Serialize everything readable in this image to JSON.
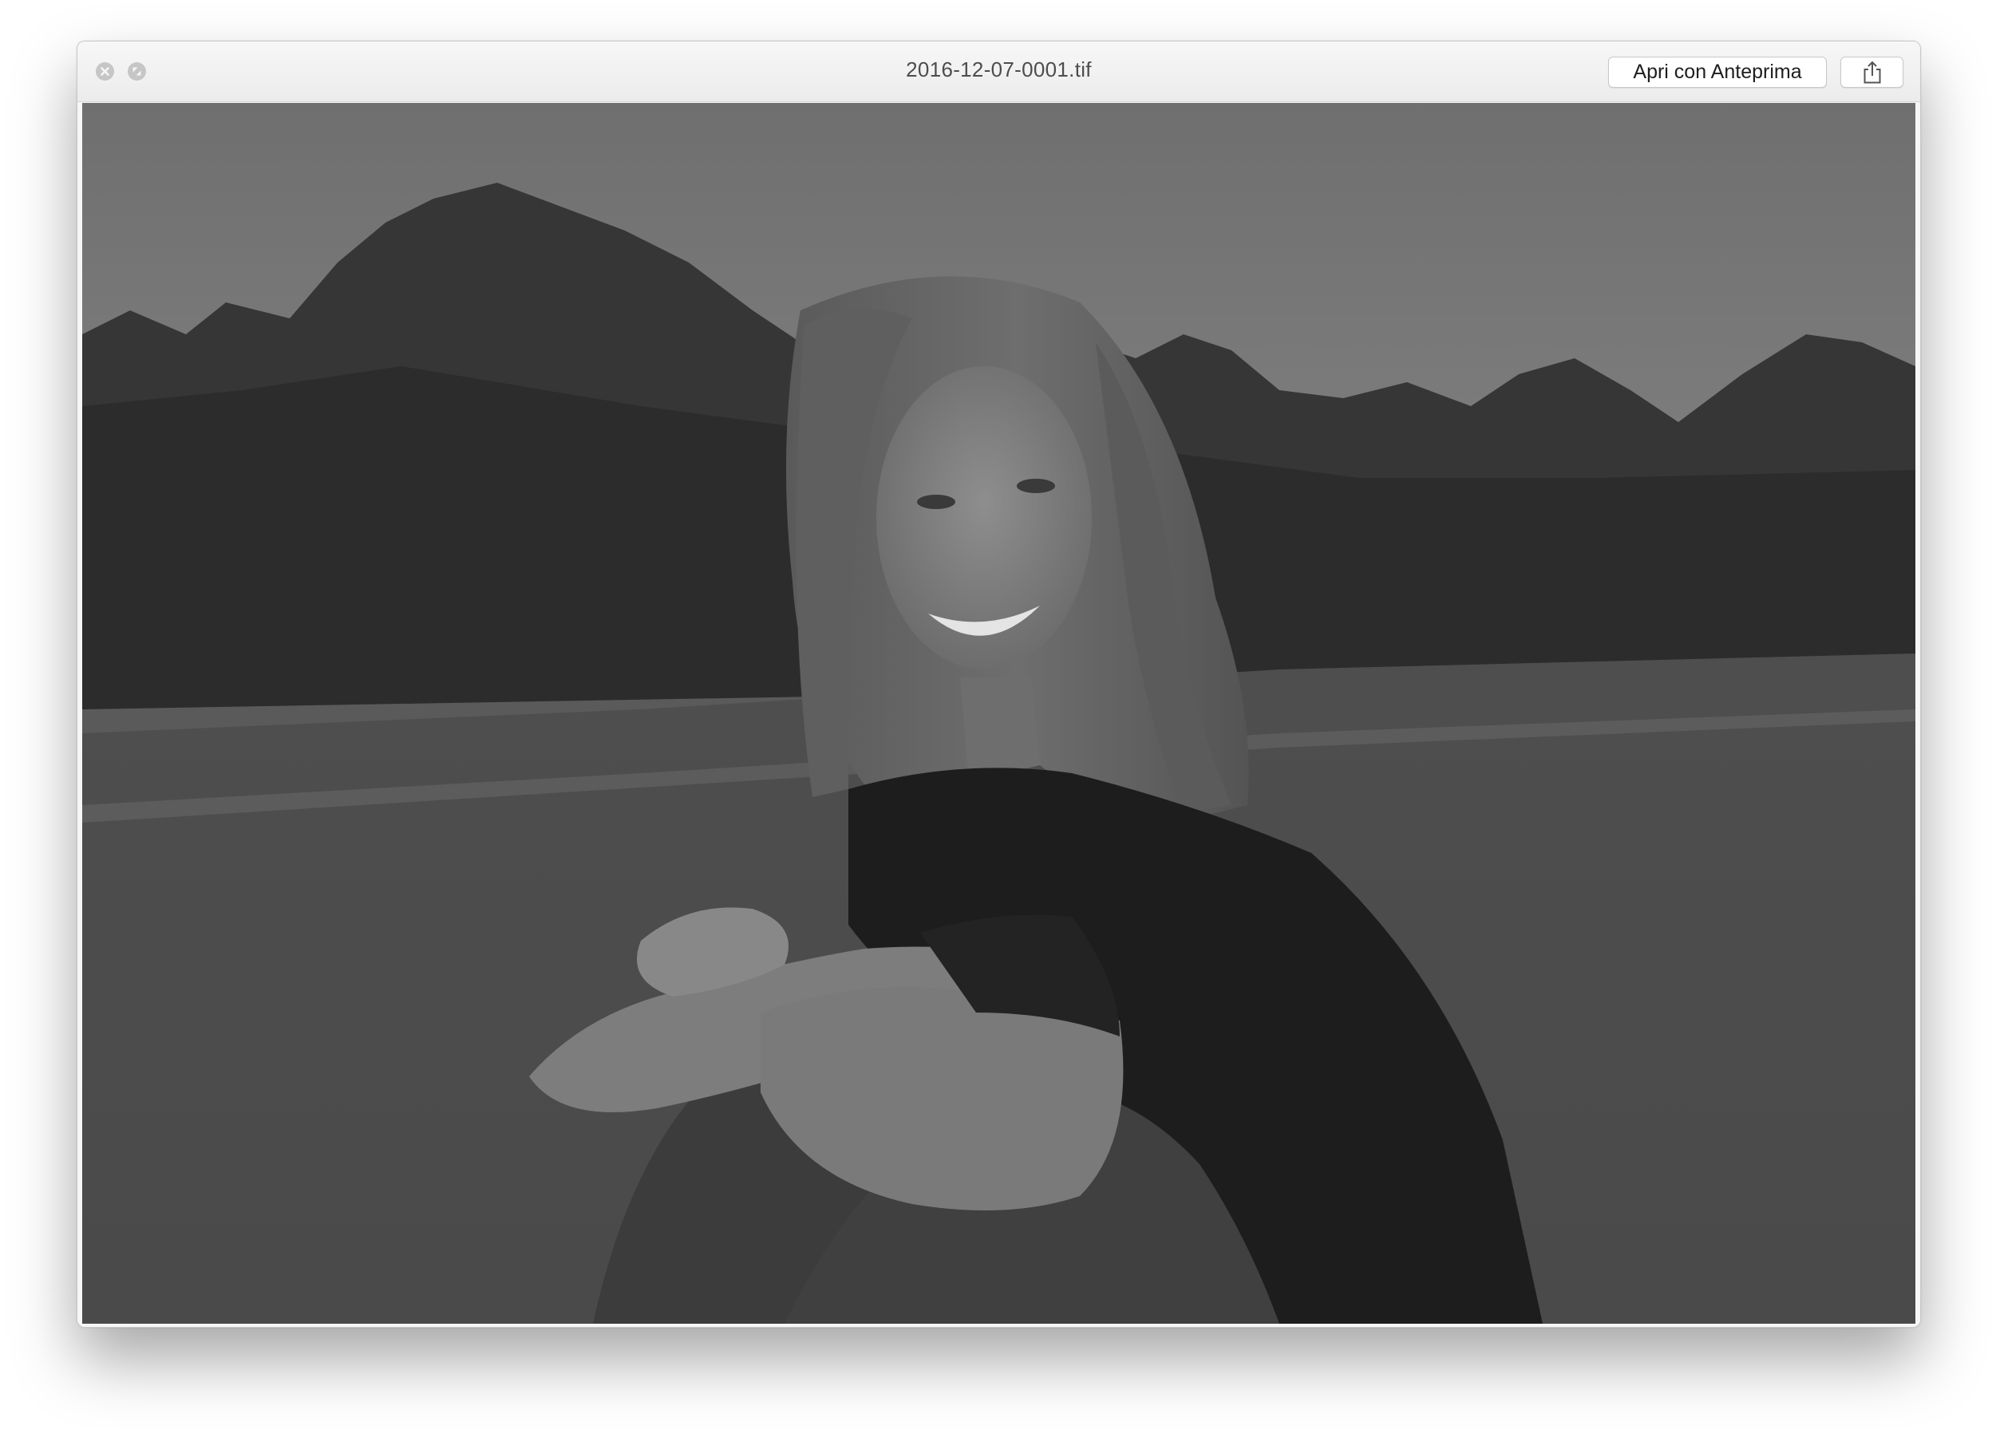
{
  "window": {
    "title": "2016-12-07-0001.tif",
    "open_with_label": "Apri con Anteprima"
  },
  "icons": {
    "close": "close-icon",
    "fullscreen": "fullscreen-icon",
    "share": "share-icon"
  },
  "colors": {
    "titlebar": "#ececec",
    "button_bg": "#ffffff",
    "traffic_light": "#c6c6c6"
  }
}
